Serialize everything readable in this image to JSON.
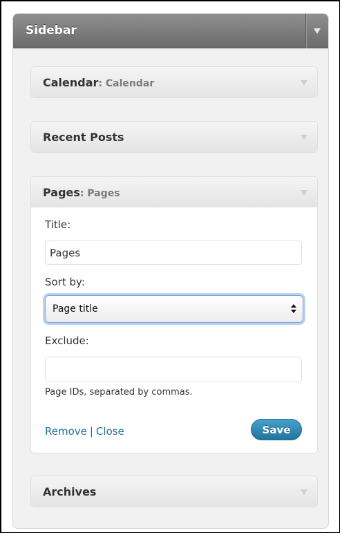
{
  "sidebar": {
    "title": "Sidebar"
  },
  "widgets": {
    "calendar": {
      "title": "Calendar",
      "subtitle": ": Calendar"
    },
    "recent_posts": {
      "title": "Recent Posts"
    },
    "pages": {
      "title": "Pages",
      "subtitle": ": Pages",
      "title_label": "Title:",
      "title_value": "Pages",
      "sort_label": "Sort by:",
      "sort_selected": "Page title",
      "exclude_label": "Exclude:",
      "exclude_value": "",
      "exclude_hint": "Page IDs, separated by commas.",
      "remove_link": "Remove",
      "separator": "|",
      "close_link": "Close",
      "save_button": "Save"
    },
    "archives": {
      "title": "Archives"
    }
  },
  "colors": {
    "link": "#21759b",
    "save_button": "#2e8dbb",
    "header_bar": "#7c7c7c",
    "focus_ring": "#b9d0ee"
  },
  "icons": {
    "sidebar_toggle": "triangle-down-icon",
    "widget_toggle": "triangle-down-icon",
    "select_arrows": "up-down-arrows-icon"
  }
}
